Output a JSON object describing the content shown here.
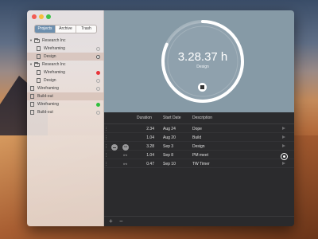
{
  "sidebar": {
    "tabs": [
      {
        "label": "Projects",
        "active": true
      },
      {
        "label": "Archive",
        "active": false
      },
      {
        "label": "Trash",
        "active": false
      }
    ],
    "tree": [
      {
        "type": "folder",
        "label": "Research Inc",
        "level": 0,
        "status": "none",
        "selected": false
      },
      {
        "type": "doc",
        "label": "Wireframing",
        "level": 1,
        "status": "empty",
        "selected": false
      },
      {
        "type": "doc",
        "label": "Design",
        "level": 1,
        "status": "active",
        "selected": true
      },
      {
        "type": "folder",
        "label": "Research Inc",
        "level": 0,
        "status": "none",
        "selected": false
      },
      {
        "type": "doc",
        "label": "Wireframing",
        "level": 1,
        "status": "red",
        "selected": false
      },
      {
        "type": "doc",
        "label": "Design",
        "level": 1,
        "status": "empty",
        "selected": false
      },
      {
        "type": "doc",
        "label": "Wireframing",
        "level": 0,
        "status": "empty",
        "selected": false
      },
      {
        "type": "doc",
        "label": "Build-out",
        "level": 0,
        "status": "none",
        "selected": true
      },
      {
        "type": "doc",
        "label": "Wireframing",
        "level": 0,
        "status": "green",
        "selected": false
      },
      {
        "type": "doc",
        "label": "Build-out",
        "level": 0,
        "status": "empty",
        "selected": false
      }
    ]
  },
  "timer": {
    "value": "3.28.37 h",
    "label": "Design",
    "progress": 0.82
  },
  "table": {
    "headers": {
      "duration": "Duration",
      "start": "Start Date",
      "desc": "Description"
    },
    "rows": [
      {
        "duration": "2.34",
        "start": "Aug 24",
        "desc": "Dope",
        "icon": "none",
        "action": "play"
      },
      {
        "duration": "1.04",
        "start": "Aug 20",
        "desc": "Build",
        "icon": "none",
        "action": "play"
      },
      {
        "duration": "3.28",
        "start": "Sep 3",
        "desc": "Design",
        "icon": "minus-link",
        "action": "play"
      },
      {
        "duration": "1.04",
        "start": "Sep 8",
        "desc": "PM meet",
        "icon": "link",
        "action": "active"
      },
      {
        "duration": "0.47",
        "start": "Sep 10",
        "desc": "TW Timer",
        "icon": "link",
        "action": "play"
      }
    ]
  },
  "bottombar": {
    "add": "+",
    "remove": "−"
  },
  "colors": {
    "accent": "#6d8fae",
    "timer_bg": "#869aa6",
    "main_bg": "#2b2b2d",
    "status_red": "#e8343a",
    "status_green": "#2fbf3c"
  }
}
